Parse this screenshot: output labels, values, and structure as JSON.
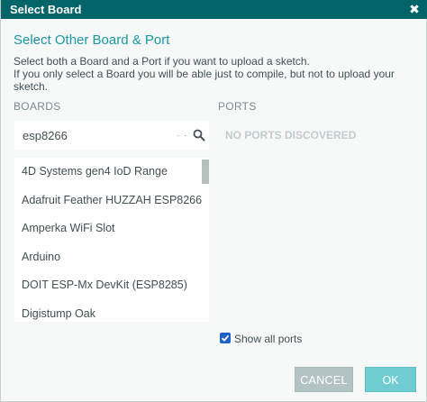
{
  "window": {
    "title": "Select Board",
    "close_glyph": "✖"
  },
  "heading": "Select Other Board & Port",
  "description": {
    "line1": "Select both a Board and a Port if you want to upload a sketch.",
    "line2": "If you only select a Board you will be able just to compile, but not to upload your",
    "line3": "sketch."
  },
  "boards": {
    "label": "BOARDS",
    "search_value": "esp8266",
    "search_dots": ". .",
    "items": [
      {
        "label": "4D Systems gen4 IoD Range"
      },
      {
        "label": "Adafruit Feather HUZZAH ESP8266"
      },
      {
        "label": "Amperka WiFi Slot"
      },
      {
        "label": "Arduino"
      },
      {
        "label": "DOIT ESP-Mx DevKit (ESP8285)"
      },
      {
        "label": "Digistump Oak"
      }
    ]
  },
  "ports": {
    "label": "PORTS",
    "empty_message": "NO PORTS DISCOVERED"
  },
  "show_all_ports": {
    "label": "Show all ports",
    "checked": true
  },
  "buttons": {
    "cancel": "CANCEL",
    "ok": "OK"
  },
  "colors": {
    "titlebar": "#006468",
    "heading": "#1a96a0",
    "ok_button": "#6fcdd1",
    "cancel_button": "#b3c3c4",
    "checkbox": "#1f63c6"
  }
}
